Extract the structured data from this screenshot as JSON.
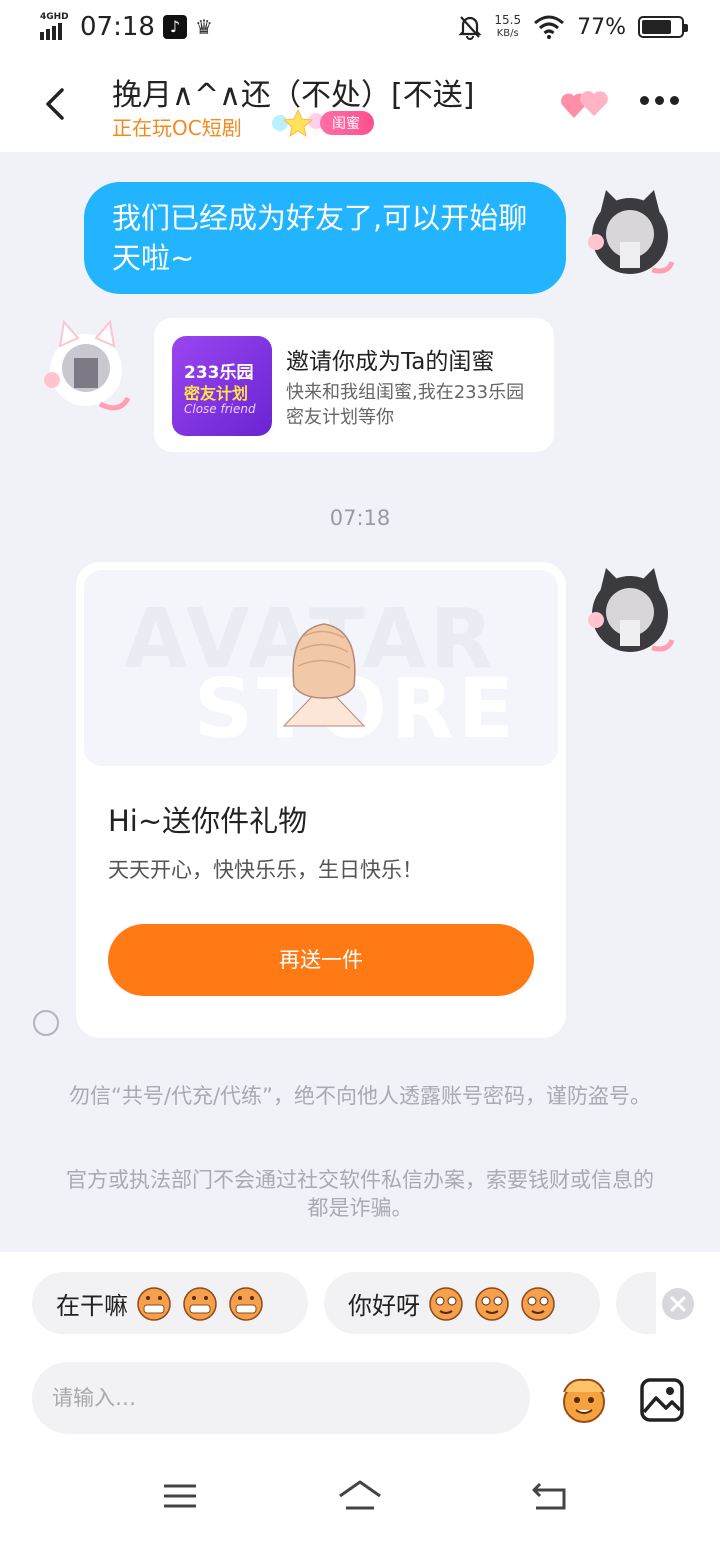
{
  "status_bar": {
    "network": "4GHD",
    "time": "07:18",
    "speed_value": "15.5",
    "speed_unit": "KB/s",
    "battery": "77%",
    "battery_level": 0.77
  },
  "header": {
    "title": "挽月∧^∧还（不处）[不送]",
    "subtitle": "正在玩OC短剧",
    "relation_badge": "闺蜜"
  },
  "messages": {
    "friend_notice": "我们已经成为好友了,可以开始聊天啦~",
    "invite": {
      "logo_line1": "233乐园",
      "logo_line2": "密友计划",
      "logo_line3": "Close friend",
      "title": "邀请你成为Ta的闺蜜",
      "desc": "快来和我组闺蜜,我在233乐园密友计划等你"
    },
    "timestamp": "07:18",
    "gift": {
      "watermark1": "AVATAR",
      "watermark2": "STORE",
      "title": "Hi~送你件礼物",
      "message": "天天开心，快快乐乐，生日快乐！",
      "button": "再送一件"
    }
  },
  "notices": [
    "勿信“共号/代充/代练”，绝不向他人透露账号密码，谨防盗号。",
    "官方或执法部门不会通过社交软件私信办案，索要钱财或信息的都是诈骗。"
  ],
  "quick_replies": [
    {
      "label": "在干嘛",
      "icon": "grinning-face-icon"
    },
    {
      "label": "你好呀",
      "icon": "smiling-face-icon"
    }
  ],
  "input": {
    "placeholder": "请输入…"
  },
  "colors": {
    "accent_blue": "#23b4ff",
    "accent_orange": "#ff7a14",
    "subtitle_orange": "#f28a1e",
    "badge_pink": "#ff4f8e"
  }
}
